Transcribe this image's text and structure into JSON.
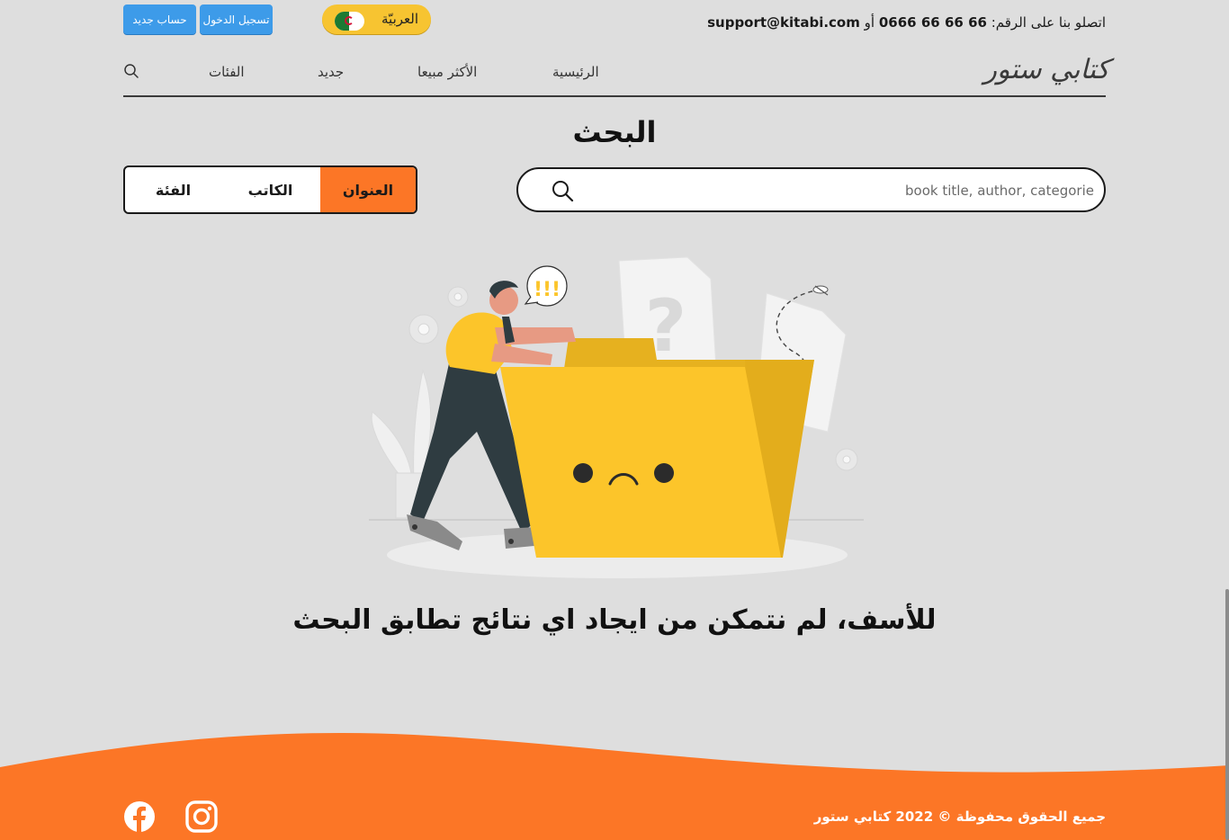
{
  "topbar": {
    "signup_label": "حساب جديد",
    "login_label": "تسجيل الدخول",
    "language_label": "العربيّة",
    "language_flag": "algeria-flag-icon",
    "contact_prefix": "اتصلو بنا على الرقم:",
    "phone": " 66 66 66 0666",
    "contact_or": "أو",
    "email": "support@kitabi.com"
  },
  "nav": {
    "logo": "كتابي ستور",
    "home": "الرئيسية",
    "best_sellers": "الأكثر مبيعا",
    "new": "جديد",
    "categories": "الفئات",
    "search_icon": "search-icon"
  },
  "search": {
    "page_title": "البحث",
    "placeholder": "book title, author, categorie",
    "value": "",
    "filters": {
      "title": "العنوان",
      "author": "الكاتب",
      "category": "الفئة",
      "active": "title"
    }
  },
  "empty_state": {
    "message": "للأسف، لم نتمكن من ايجاد اي نتائج تطابق البحث",
    "illustration_alert": "!!!"
  },
  "footer": {
    "copyright": "جميع الحقوق محفوظة © 2022 كتابي ستور",
    "social": [
      "facebook-icon",
      "instagram-icon"
    ]
  },
  "colors": {
    "accent": "#fc7626",
    "primary_blue": "#3d9be9",
    "folder_yellow": "#fcc52a",
    "background": "#dedede"
  }
}
